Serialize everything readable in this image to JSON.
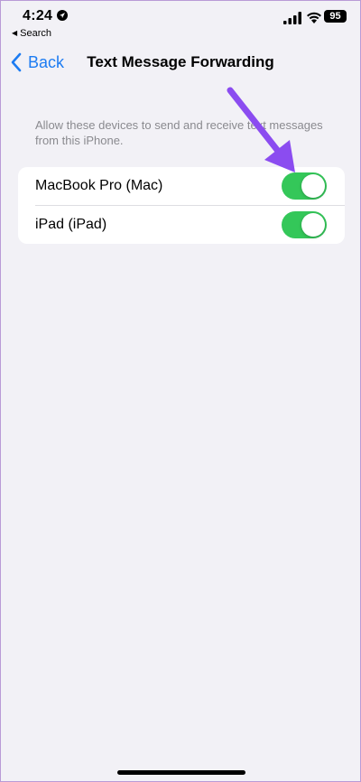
{
  "status_bar": {
    "time": "4:24",
    "battery": "95",
    "back_app": "Search"
  },
  "nav": {
    "back_label": "Back",
    "title": "Text Message Forwarding"
  },
  "section": {
    "footer_text": "Allow these devices to send and receive text messages from this iPhone."
  },
  "devices": [
    {
      "label": "MacBook Pro (Mac)",
      "enabled": true
    },
    {
      "label": "iPad (iPad)",
      "enabled": true
    }
  ],
  "colors": {
    "accent": "#1d7cf2",
    "toggle_on": "#34c759",
    "annotation_arrow": "#8b4cf0"
  }
}
